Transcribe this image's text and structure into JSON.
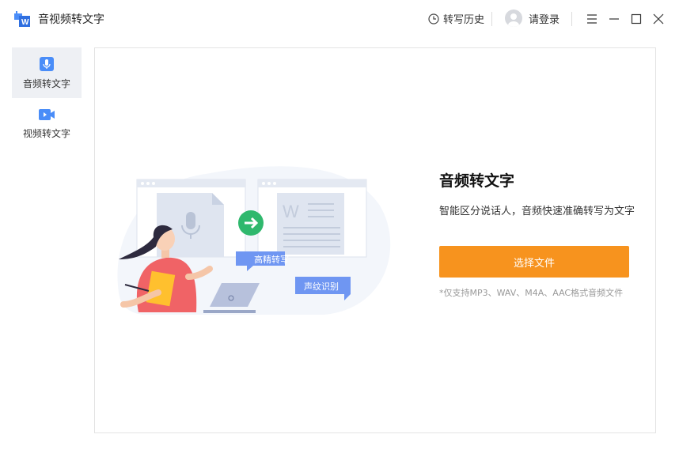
{
  "app": {
    "title": "音视频转文字"
  },
  "header": {
    "history_label": "转写历史",
    "login_label": "请登录"
  },
  "sidebar": {
    "items": [
      {
        "label": "音频转文字",
        "icon": "microphone-icon",
        "active": true
      },
      {
        "label": "视频转文字",
        "icon": "video-camera-icon",
        "active": false
      }
    ]
  },
  "main": {
    "title": "音频转文字",
    "description": "智能区分说话人，音频快速准确转写为文字",
    "choose_button": "选择文件",
    "supported_formats": "*仅支持MP3、WAV、M4A、AAC格式音频文件",
    "illustration": {
      "bubble_1": "高精转写",
      "bubble_2": "声纹识别"
    }
  },
  "colors": {
    "accent_orange": "#f7931e",
    "brand_blue": "#4a8df8",
    "arrow_green": "#2fb86d"
  }
}
